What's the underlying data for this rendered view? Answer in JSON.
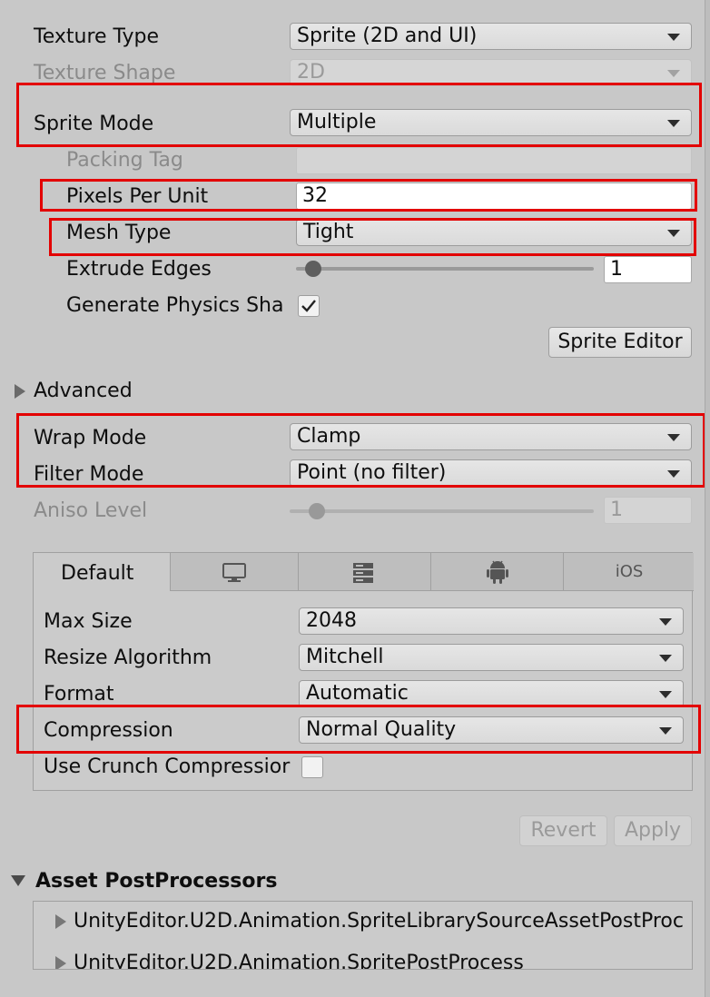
{
  "sprite_settings": {
    "texture_type": {
      "label": "Texture Type",
      "value": "Sprite (2D and UI)"
    },
    "texture_shape": {
      "label": "Texture Shape",
      "value": "2D"
    },
    "sprite_mode": {
      "label": "Sprite Mode",
      "value": "Multiple"
    },
    "packing_tag": {
      "label": "Packing Tag",
      "value": ""
    },
    "pixels_per_unit": {
      "label": "Pixels Per Unit",
      "value": "32"
    },
    "mesh_type": {
      "label": "Mesh Type",
      "value": "Tight"
    },
    "extrude_edges": {
      "label": "Extrude Edges",
      "value": "1",
      "slider_fraction": 0.03
    },
    "generate_physics": {
      "label": "Generate Physics Sha",
      "checked": true
    },
    "sprite_editor_button": "Sprite Editor"
  },
  "advanced": {
    "label": "Advanced",
    "expanded": false
  },
  "wrap_mode": {
    "label": "Wrap Mode",
    "value": "Clamp"
  },
  "filter_mode": {
    "label": "Filter Mode",
    "value": "Point (no filter)"
  },
  "aniso_level": {
    "label": "Aniso Level",
    "value": "1",
    "slider_fraction": 0.1
  },
  "platform": {
    "tabs": [
      {
        "label": "Default",
        "icon": null,
        "active": true
      },
      {
        "label": "",
        "icon": "monitor-icon",
        "active": false
      },
      {
        "label": "",
        "icon": "server-icon",
        "active": false
      },
      {
        "label": "",
        "icon": "android-icon",
        "active": false
      },
      {
        "label": "iOS",
        "icon": null,
        "active": false
      }
    ],
    "max_size": {
      "label": "Max Size",
      "value": "2048"
    },
    "resize_algorithm": {
      "label": "Resize Algorithm",
      "value": "Mitchell"
    },
    "format": {
      "label": "Format",
      "value": "Automatic"
    },
    "compression": {
      "label": "Compression",
      "value": "Normal Quality"
    },
    "use_crunch": {
      "label": "Use Crunch Compressior",
      "checked": false
    }
  },
  "actions": {
    "revert": "Revert",
    "apply": "Apply"
  },
  "postprocessors": {
    "title": "Asset PostProcessors",
    "items": [
      "UnityEditor.U2D.Animation.SpriteLibrarySourceAssetPostProc",
      "UnityEditor.U2D.Animation.SpritePostProcess"
    ]
  },
  "colors": {
    "highlight": "#e30000",
    "background": "#c8c8c8",
    "tab_accent": "#3b8fd6"
  }
}
